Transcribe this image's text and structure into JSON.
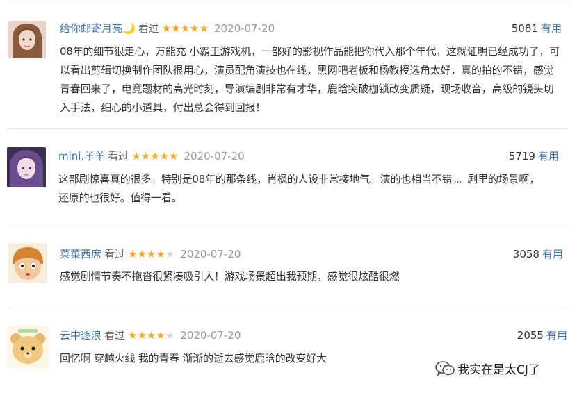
{
  "reviews": [
    {
      "username": "给你邮寄月亮🌙",
      "watched": "看过",
      "stars": "★★★★★",
      "stars_off": "",
      "rating": 5,
      "date": "2020-07-20",
      "count": "5081",
      "useful": "有用",
      "content": "08年的细节很走心，万能充 小霸王游戏机，一部好的影视作品能把你代入那个年代，这就证明已经成功了，可以看出剪辑切换制作团队很用心，演员配角演技也在线，黑网吧老板和杨教授选角太好，真的拍的不错，感觉青春回来了，电竞题材的高光时刻，导演编剧非常有才华，鹿晗突破枷锁改变质疑，现场收音，高级的镜头切入手法，细心的小道具，付出总会得到回报！"
    },
    {
      "username": "mini.羊羊",
      "watched": "看过",
      "stars": "★★★★★",
      "stars_off": "",
      "rating": 5,
      "date": "2020-07-20",
      "count": "5719",
      "useful": "有用",
      "content": "这部剧惊喜真的很多。特别是08年的那条线，肖枫的人设非常接地气。演的也相当不错。。剧里的场景啊，还原的也很好。值得一看。"
    },
    {
      "username": "菜菜西席",
      "watched": "看过",
      "stars": "★★★★",
      "stars_off": "★",
      "rating": 4,
      "date": "2020-07-20",
      "count": "3058",
      "useful": "有用",
      "content": "感觉剧情节奏不拖沓很紧凑吸引人！游戏场景超出我预期，感觉很炫酷很燃"
    },
    {
      "username": "云中逐浪",
      "watched": "看过",
      "stars": "★★★★",
      "stars_off": "★",
      "rating": 4,
      "date": "2020-07-20",
      "count": "2055",
      "useful": "有用",
      "content": "回忆啊 穿越火线 我的青春 渐渐的逝去感觉鹿晗的改变好大"
    }
  ],
  "watermark": {
    "text": "我实在是太CJ了",
    "icon": "wechat-icon"
  },
  "colors": {
    "link": "#3d72a8",
    "star": "#f5a623",
    "date": "#999999"
  }
}
